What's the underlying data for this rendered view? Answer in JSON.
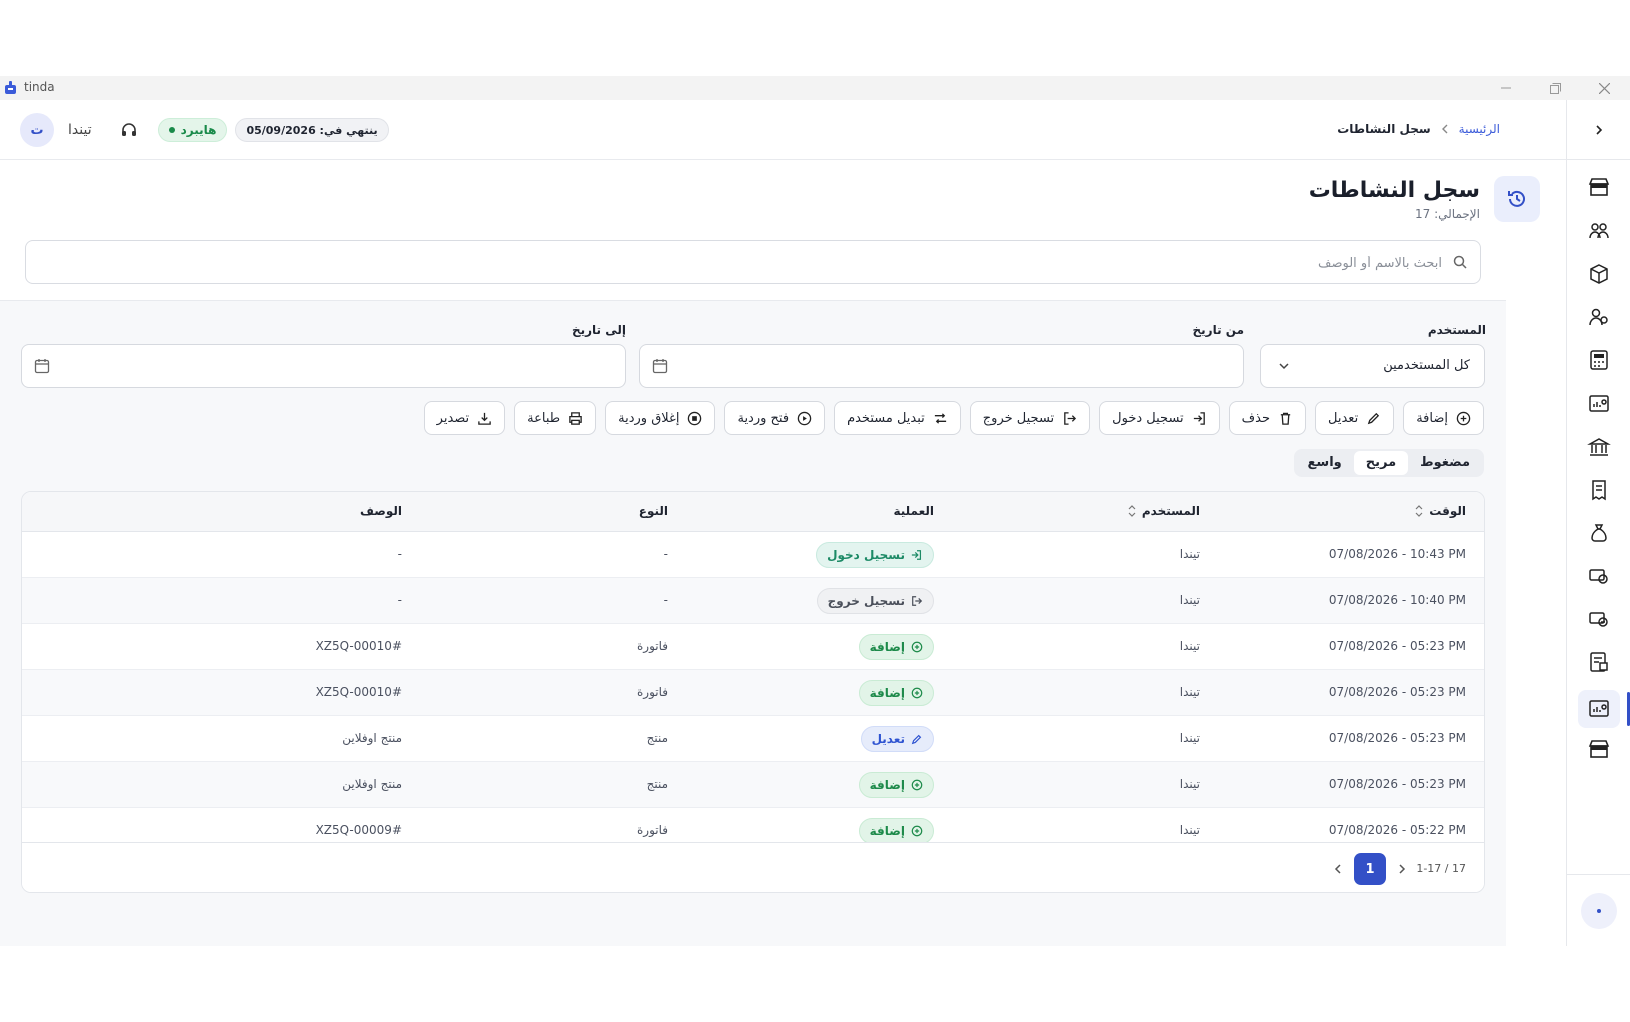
{
  "window": {
    "app_name": "tinda"
  },
  "topbar": {
    "breadcrumb": {
      "home": "الرئيسية",
      "current": "سجل النشاطات"
    },
    "expiry": "ينتهي في: 05/09/2026",
    "plan_badge": "هايبرد",
    "user_name": "تيندا",
    "avatar_letter": "ت"
  },
  "page": {
    "title": "سجل النشاطات",
    "subtitle": "الإجمالي: 17"
  },
  "search": {
    "placeholder": "ابحث بالاسم أو الوصف",
    "value": ""
  },
  "filters": {
    "user_label": "المستخدم",
    "user_value": "كل المستخدمين",
    "from_label": "من تاريخ",
    "to_label": "إلى تاريخ"
  },
  "actions": [
    "إضافة",
    "تعديل",
    "حذف",
    "تسجيل دخول",
    "تسجيل خروج",
    "تبديل مستخدم",
    "فتح وردية",
    "إغلاق وردية",
    "طباعة",
    "تصدير"
  ],
  "density": {
    "options": [
      "مضغوط",
      "مريح",
      "واسع"
    ],
    "selected": "مريح"
  },
  "table": {
    "headers": {
      "time": "الوقت",
      "user": "المستخدم",
      "operation": "العملية",
      "type": "النوع",
      "description": "الوصف"
    },
    "rows": [
      {
        "time": "07/08/2026 - 10:43 PM",
        "user": "تيندا",
        "operation": "تسجيل دخول",
        "op_kind": "login",
        "type": "-",
        "description": "-"
      },
      {
        "time": "07/08/2026 - 10:40 PM",
        "user": "تيندا",
        "operation": "تسجيل خروج",
        "op_kind": "logout",
        "type": "-",
        "description": "-"
      },
      {
        "time": "07/08/2026 - 05:23 PM",
        "user": "تيندا",
        "operation": "إضافة",
        "op_kind": "add",
        "type": "فاتورة",
        "description": "#XZ5Q-00010"
      },
      {
        "time": "07/08/2026 - 05:23 PM",
        "user": "تيندا",
        "operation": "إضافة",
        "op_kind": "add",
        "type": "فاتورة",
        "description": "#XZ5Q-00010"
      },
      {
        "time": "07/08/2026 - 05:23 PM",
        "user": "تيندا",
        "operation": "تعديل",
        "op_kind": "edit",
        "type": "منتج",
        "description": "منتج اوفلاين"
      },
      {
        "time": "07/08/2026 - 05:23 PM",
        "user": "تيندا",
        "operation": "إضافة",
        "op_kind": "add",
        "type": "منتج",
        "description": "منتج اوفلاين"
      },
      {
        "time": "07/08/2026 - 05:22 PM",
        "user": "تيندا",
        "operation": "إضافة",
        "op_kind": "add",
        "type": "فاتورة",
        "description": "#XZ5Q-00009"
      }
    ]
  },
  "pagination": {
    "range": "1-17 / 17",
    "current_page": "1"
  },
  "colors": {
    "accent": "#3350c7",
    "success": "#1d8a4a",
    "login": "#1d8a66",
    "edit": "#2f54d1"
  }
}
